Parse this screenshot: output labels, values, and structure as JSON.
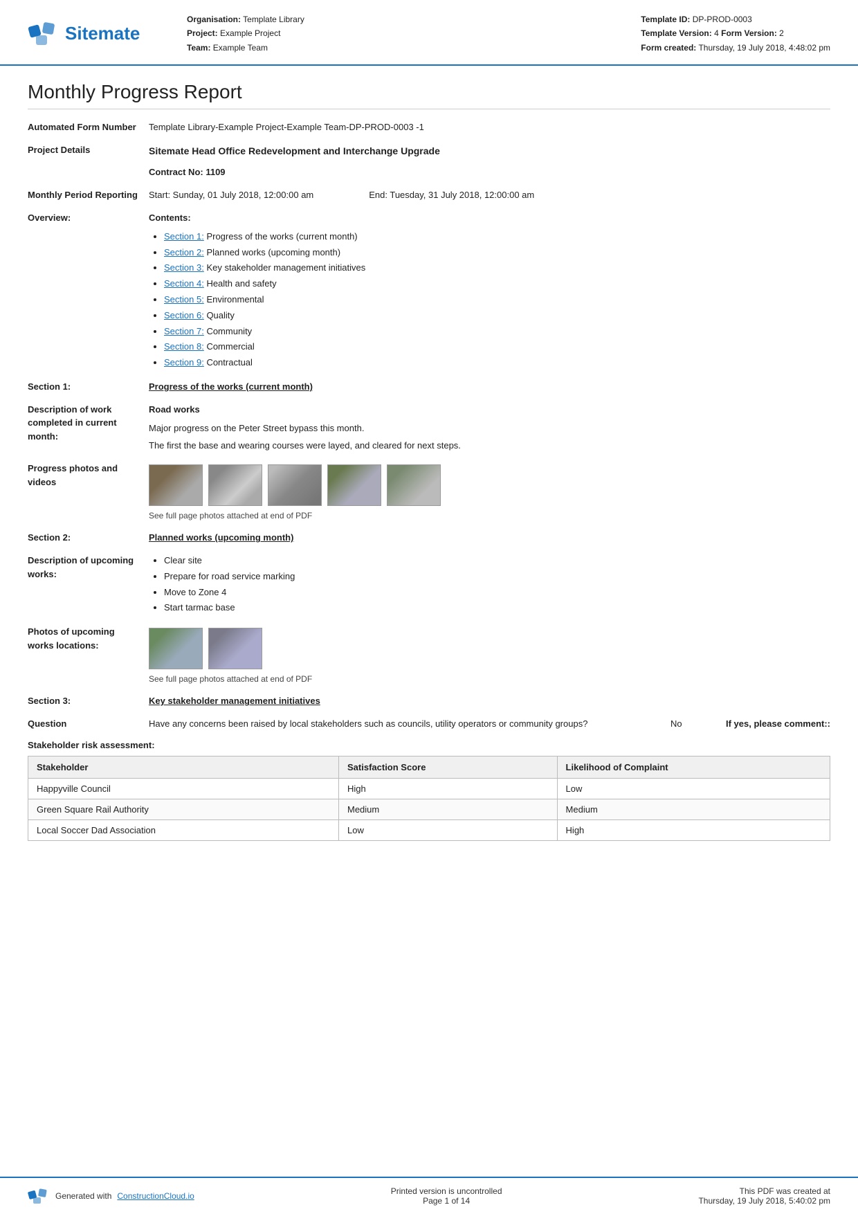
{
  "header": {
    "logo_text": "Sitemate",
    "org_label": "Organisation:",
    "org_value": "Template Library",
    "project_label": "Project:",
    "project_value": "Example Project",
    "team_label": "Team:",
    "team_value": "Example Team",
    "template_id_label": "Template ID:",
    "template_id_value": "DP-PROD-0003",
    "template_version_label": "Template Version:",
    "template_version_value": "4",
    "form_version_label": "Form Version:",
    "form_version_value": "2",
    "form_created_label": "Form created:",
    "form_created_value": "Thursday, 19 July 2018, 4:48:02 pm"
  },
  "report": {
    "title": "Monthly Progress Report",
    "automated_form_label": "Automated Form Number",
    "automated_form_value": "Template Library-Example Project-Example Team-DP-PROD-0003   -1",
    "project_details_label": "Project Details",
    "project_details_value": "Sitemate Head Office Redevelopment and Interchange Upgrade",
    "contract_no_value": "Contract No: 1109",
    "monthly_period_label": "Monthly Period Reporting",
    "period_start": "Start: Sunday, 01 July 2018, 12:00:00 am",
    "period_end": "End: Tuesday, 31 July 2018, 12:00:00 am",
    "overview_label": "Overview:",
    "contents_label": "Contents:",
    "contents_items": [
      {
        "link": "Section 1:",
        "text": " Progress of the works (current month)"
      },
      {
        "link": "Section 2:",
        "text": " Planned works (upcoming month)"
      },
      {
        "link": "Section 3:",
        "text": " Key stakeholder management initiatives"
      },
      {
        "link": "Section 4:",
        "text": " Health and safety"
      },
      {
        "link": "Section 5:",
        "text": " Environmental"
      },
      {
        "link": "Section 6:",
        "text": " Quality"
      },
      {
        "link": "Section 7:",
        "text": " Community"
      },
      {
        "link": "Section 8:",
        "text": " Commercial"
      },
      {
        "link": "Section 9:",
        "text": " Contractual"
      }
    ],
    "section1_label": "Section 1:",
    "section1_heading": "Progress of the works (current month)",
    "desc_work_label": "Description of work completed in current month:",
    "road_works_heading": "Road works",
    "road_works_desc1": "Major progress on the Peter Street bypass this month.",
    "road_works_desc2": "The first the base and wearing courses were layed, and cleared for next steps.",
    "progress_photos_label": "Progress photos and videos",
    "photos_note": "See full page photos attached at end of PDF",
    "section2_label": "Section 2:",
    "section2_heading": "Planned works (upcoming month)",
    "upcoming_works_label": "Description of upcoming works:",
    "upcoming_works_items": [
      "Clear site",
      "Prepare for road service marking",
      "Move to Zone 4",
      "Start tarmac base"
    ],
    "upcoming_photos_label": "Photos of upcoming works locations:",
    "upcoming_photos_note": "See full page photos attached at end of PDF",
    "section3_label": "Section 3:",
    "section3_heading": "Key stakeholder management initiatives",
    "question_label": "Question",
    "question_text": "Have any concerns been raised by local stakeholders such as councils, utility operators or community groups?",
    "question_no": "No",
    "question_comment": "If yes, please comment::",
    "stakeholder_table_title": "Stakeholder risk assessment:",
    "table_headers": [
      "Stakeholder",
      "Satisfaction Score",
      "Likelihood of Complaint"
    ],
    "table_rows": [
      [
        "Happyville Council",
        "High",
        "Low"
      ],
      [
        "Green Square Rail Authority",
        "Medium",
        "Medium"
      ],
      [
        "Local Soccer Dad Association",
        "Low",
        "High"
      ]
    ]
  },
  "footer": {
    "generated_label": "Generated with",
    "generated_link": "ConstructionCloud.io",
    "print_note": "Printed version is uncontrolled",
    "page_info": "Page 1 of 14",
    "pdf_created": "This PDF was created at",
    "pdf_date": "Thursday, 19 July 2018, 5:40:02 pm"
  }
}
